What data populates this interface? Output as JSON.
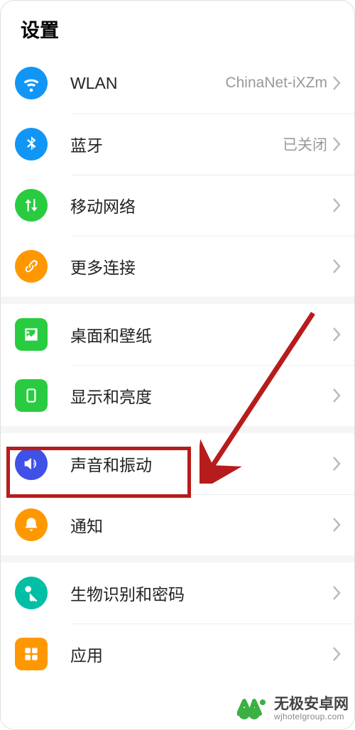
{
  "header": {
    "title": "设置"
  },
  "groups": [
    {
      "items": [
        {
          "icon": "wifi-icon",
          "bg": "#1296f5",
          "label": "WLAN",
          "value": "ChinaNet-iXZm"
        },
        {
          "icon": "bluetooth-icon",
          "bg": "#1296f5",
          "label": "蓝牙",
          "value": "已关闭"
        },
        {
          "icon": "mobile-data-icon",
          "bg": "#29cc40",
          "label": "移动网络",
          "value": ""
        },
        {
          "icon": "more-connections-icon",
          "bg": "#ff9800",
          "label": "更多连接",
          "value": ""
        }
      ]
    },
    {
      "items": [
        {
          "icon": "wallpaper-icon",
          "bg": "#29cc40",
          "label": "桌面和壁纸",
          "value": "",
          "shape": "rounded-box"
        },
        {
          "icon": "display-icon",
          "bg": "#29cc40",
          "label": "显示和亮度",
          "value": "",
          "shape": "rounded-box"
        }
      ]
    },
    {
      "items": [
        {
          "icon": "sound-icon",
          "bg": "#3f51e6",
          "label": "声音和振动",
          "value": "",
          "highlighted": true
        },
        {
          "icon": "notification-icon",
          "bg": "#ff9800",
          "label": "通知",
          "value": ""
        }
      ]
    },
    {
      "items": [
        {
          "icon": "biometric-icon",
          "bg": "#00bfa5",
          "label": "生物识别和密码",
          "value": ""
        },
        {
          "icon": "apps-icon",
          "bg": "#ff9800",
          "label": "应用",
          "value": "",
          "shape": "rounded-box"
        }
      ]
    }
  ],
  "watermark": {
    "title": "无极安卓网",
    "url": "wjhotelgroup.com"
  }
}
